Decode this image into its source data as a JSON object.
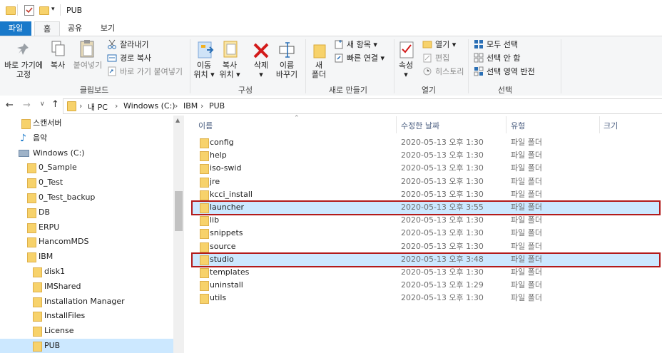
{
  "window": {
    "title": "PUB"
  },
  "ribbon_tabs": [
    "파일",
    "홈",
    "공유",
    "보기"
  ],
  "clipboard": {
    "pin_label": "바로 가기에\n고정",
    "copy_label": "복사",
    "paste_label": "붙여넣기",
    "cut": "잘라내기",
    "copy_path": "경로 복사",
    "paste_shortcut": "바로 가기 붙여넣기",
    "group": "클립보드"
  },
  "organize": {
    "move_label": "이동\n위치 ▾",
    "copyto_label": "복사\n위치 ▾",
    "delete_label": "삭제\n▾",
    "rename_label": "이름\n바꾸기",
    "group": "구성"
  },
  "new": {
    "new_folder_label": "새\n폴더",
    "new_item": "새 항목 ▾",
    "easy_access": "빠른 연결 ▾",
    "group": "새로 만들기"
  },
  "open": {
    "properties_label": "속성\n▾",
    "open": "열기 ▾",
    "edit": "편집",
    "history": "히스토리",
    "group": "열기"
  },
  "select": {
    "select_all": "모두 선택",
    "select_none": "선택 안 함",
    "invert": "선택 영역 반전",
    "group": "선택"
  },
  "address": {
    "crumbs": [
      "내 PC",
      "Windows (C:)",
      "IBM",
      "PUB"
    ]
  },
  "nav": [
    {
      "label": "스캔서버",
      "indent": 0,
      "icon": "folder-icon"
    },
    {
      "label": "음악",
      "indent": 0,
      "icon": "music-icon"
    },
    {
      "label": "Windows  (C:)",
      "indent": 0,
      "icon": "drive-icon"
    },
    {
      "label": "0_Sample",
      "indent": 1,
      "icon": "folder-icon"
    },
    {
      "label": "0_Test",
      "indent": 1,
      "icon": "folder-icon"
    },
    {
      "label": "0_Test_backup",
      "indent": 1,
      "icon": "folder-icon"
    },
    {
      "label": "DB",
      "indent": 1,
      "icon": "folder-icon"
    },
    {
      "label": "ERPU",
      "indent": 1,
      "icon": "folder-icon"
    },
    {
      "label": "HancomMDS",
      "indent": 1,
      "icon": "folder-icon"
    },
    {
      "label": "IBM",
      "indent": 1,
      "icon": "folder-icon"
    },
    {
      "label": "disk1",
      "indent": 2,
      "icon": "folder-icon"
    },
    {
      "label": "IMShared",
      "indent": 2,
      "icon": "folder-icon"
    },
    {
      "label": "Installation Manager",
      "indent": 2,
      "icon": "folder-icon"
    },
    {
      "label": "InstallFiles",
      "indent": 2,
      "icon": "folder-icon"
    },
    {
      "label": "License",
      "indent": 2,
      "icon": "folder-icon"
    },
    {
      "label": "PUB",
      "indent": 2,
      "icon": "folder-icon",
      "selected": true
    }
  ],
  "columns": {
    "name": "이름",
    "date": "수정한 날짜",
    "type": "유형",
    "size": "크기"
  },
  "files": [
    {
      "name": "config",
      "date": "2020-05-13 오후 1:30",
      "type": "파일 폴더"
    },
    {
      "name": "help",
      "date": "2020-05-13 오후 1:30",
      "type": "파일 폴더"
    },
    {
      "name": "iso-swid",
      "date": "2020-05-13 오후 1:30",
      "type": "파일 폴더"
    },
    {
      "name": "jre",
      "date": "2020-05-13 오후 1:30",
      "type": "파일 폴더"
    },
    {
      "name": "kcci_install",
      "date": "2020-05-13 오후 1:30",
      "type": "파일 폴더"
    },
    {
      "name": "launcher",
      "date": "2020-05-13 오후 3:55",
      "type": "파일 폴더",
      "highlighted": true
    },
    {
      "name": "lib",
      "date": "2020-05-13 오후 1:30",
      "type": "파일 폴더"
    },
    {
      "name": "snippets",
      "date": "2020-05-13 오후 1:30",
      "type": "파일 폴더"
    },
    {
      "name": "source",
      "date": "2020-05-13 오후 1:30",
      "type": "파일 폴더"
    },
    {
      "name": "studio",
      "date": "2020-05-13 오후 3:48",
      "type": "파일 폴더",
      "highlighted": true
    },
    {
      "name": "templates",
      "date": "2020-05-13 오후 1:30",
      "type": "파일 폴더"
    },
    {
      "name": "uninstall",
      "date": "2020-05-13 오후 1:29",
      "type": "파일 폴더"
    },
    {
      "name": "utils",
      "date": "2020-05-13 오후 1:30",
      "type": "파일 폴더"
    }
  ],
  "colors": {
    "accent": "#1979ca",
    "selection": "#cce8ff",
    "highlight_border": "#b31b1b"
  }
}
